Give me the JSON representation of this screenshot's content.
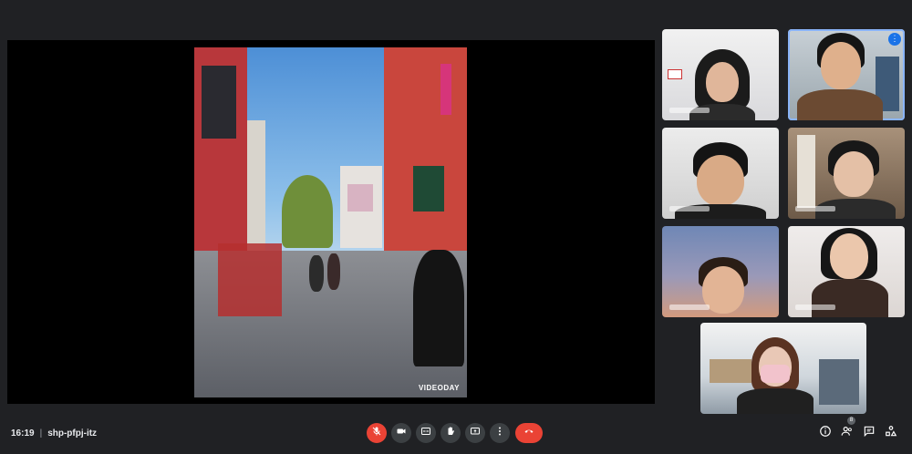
{
  "meeting": {
    "time": "16:19",
    "separator": "|",
    "code": "shp-pfpj-itz"
  },
  "presentation": {
    "watermark": "VIDEODAY"
  },
  "participants_panel": {
    "people_count": "8",
    "more_options": "⋮"
  },
  "colors": {
    "background": "#202124",
    "control": "#3c4043",
    "danger": "#ea4335",
    "active_speaker": "#8ab4f8"
  },
  "icons": [
    "mic-off-icon",
    "camera-icon",
    "captions-icon",
    "raise-hand-icon",
    "present-icon",
    "more-icon",
    "end-call-icon",
    "info-icon",
    "people-icon",
    "chat-icon",
    "activities-icon"
  ]
}
